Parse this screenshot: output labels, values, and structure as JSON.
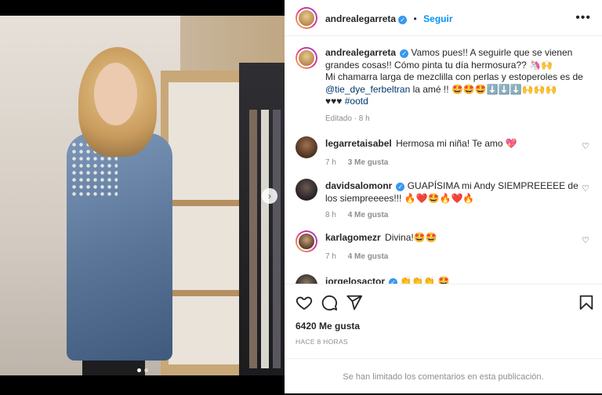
{
  "post": {
    "username": "andrealegarreta",
    "follow_label": "Seguir",
    "more_label": "•••",
    "next_label": "›",
    "caption_line1": "Vamos pues!! A seguirle que se vienen grandes cosas!! Cómo pinta tu día hermosura?? 🦄🙌",
    "caption_line2": "Mi chamarra larga de mezclilla con perlas y estoperoles es de ",
    "caption_mention": "@tie_dye_ferbeltran",
    "caption_line3": " la amé !! 🤩🤩🤩⬇️⬇️⬇️🙌🙌🙌",
    "caption_line4": "♥♥♥ ",
    "caption_hashtag": "#ootd",
    "edited_label": "Editado · 8 h",
    "likes_label": "6420 Me gusta",
    "time_ago": "HACE 8 HORAS",
    "comments_limited": "Se han limitado los comentarios en esta publicación."
  },
  "comments": [
    {
      "username": "legarretaisabel",
      "text": "Hermosa mi niña! Te amo 💖",
      "time": "7 h",
      "likes": "3 Me gusta",
      "verified": false
    },
    {
      "username": "davidsalomonr",
      "text": "GUAPÍSIMA mi Andy SIEMPREEEEE de los siempreeees!!! 🔥❤️🤩🔥❤️🔥",
      "time": "8 h",
      "likes": "4 Me gusta",
      "verified": true
    },
    {
      "username": "karlagomezr",
      "text": "Divina!🤩🤩",
      "time": "7 h",
      "likes": "4 Me gusta",
      "verified": false
    },
    {
      "username": "jorgelosactor",
      "text": "👏👏👏 🤩",
      "verified": true
    }
  ],
  "icons": {
    "like": "heart-icon",
    "comment": "comment-icon",
    "share": "share-icon",
    "save": "bookmark-icon"
  },
  "colors": {
    "accent": "#0095f6",
    "verified": "#3897f0",
    "muted": "#8e8e8e"
  }
}
